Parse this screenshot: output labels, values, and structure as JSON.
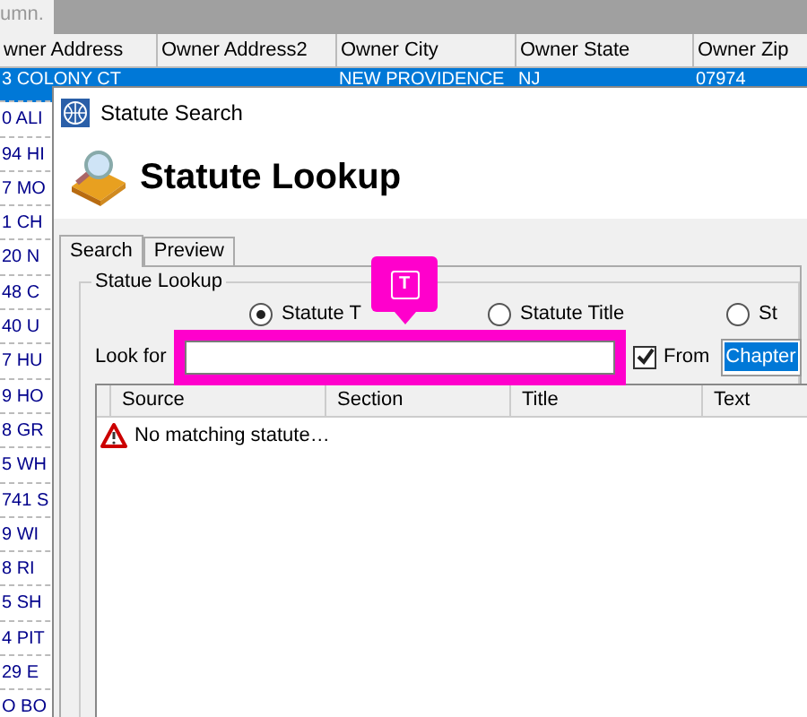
{
  "background_grid": {
    "hint": "umn.",
    "columns": [
      "wner Address",
      "Owner Address2",
      "Owner City",
      "Owner State",
      "Owner Zip"
    ],
    "rows": [
      {
        "cells": [
          "3 COLONY CT",
          "",
          "NEW PROVIDENCE",
          "NJ",
          "07974"
        ],
        "selected": true
      },
      {
        "cells": [
          "0 ALI"
        ],
        "selected": false
      },
      {
        "cells": [
          "94 HI"
        ],
        "selected": false
      },
      {
        "cells": [
          "7 MO"
        ],
        "selected": false
      },
      {
        "cells": [
          "1 CH"
        ],
        "selected": false
      },
      {
        "cells": [
          "20 N"
        ],
        "selected": false
      },
      {
        "cells": [
          "48 C"
        ],
        "selected": false
      },
      {
        "cells": [
          "40 U"
        ],
        "selected": false
      },
      {
        "cells": [
          "7 HU"
        ],
        "selected": false
      },
      {
        "cells": [
          "9 HO"
        ],
        "selected": false
      },
      {
        "cells": [
          "8 GR"
        ],
        "selected": false
      },
      {
        "cells": [
          "5 WH"
        ],
        "selected": false
      },
      {
        "cells": [
          "741 S"
        ],
        "selected": false
      },
      {
        "cells": [
          "9 WI"
        ],
        "selected": false
      },
      {
        "cells": [
          "8 RI"
        ],
        "selected": false
      },
      {
        "cells": [
          "5 SH"
        ],
        "selected": false
      },
      {
        "cells": [
          "4 PIT"
        ],
        "selected": false
      },
      {
        "cells": [
          "29 E"
        ],
        "selected": false
      },
      {
        "cells": [
          "O BO"
        ],
        "selected": false
      }
    ]
  },
  "dialog": {
    "title": "Statute Search",
    "heading": "Statute Lookup",
    "tabs": [
      {
        "label": "Search",
        "selected": true
      },
      {
        "label": "Preview",
        "selected": false
      }
    ],
    "group_title": "Statue Lookup",
    "radios": [
      {
        "label": "Statute T",
        "selected": true
      },
      {
        "label": "Statute Title",
        "selected": false
      },
      {
        "label": "St",
        "selected": false
      }
    ],
    "look_for": {
      "label": "Look for",
      "highlighted": true
    },
    "from": {
      "label": "From",
      "checked": true
    },
    "from_dropdown": {
      "value": "Chapter"
    },
    "results": {
      "columns": [
        "Source",
        "Section",
        "Title",
        "Text"
      ],
      "message": "No matching statute…"
    },
    "annotation": {
      "badge": "T"
    }
  }
}
